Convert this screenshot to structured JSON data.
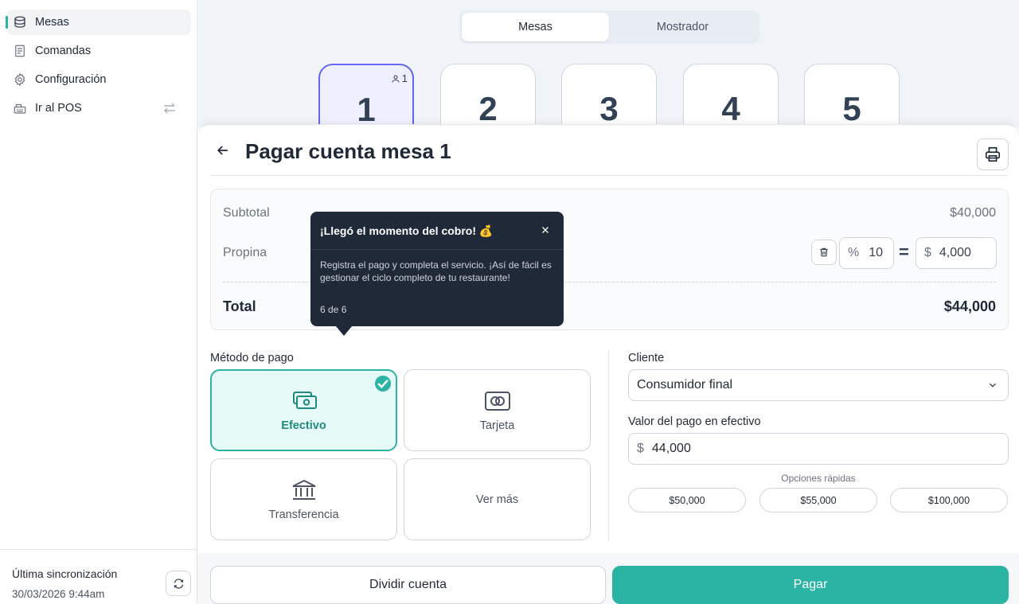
{
  "sidebar": {
    "items": [
      {
        "label": "Mesas",
        "icon": "layers-icon"
      },
      {
        "label": "Comandas",
        "icon": "receipt-icon"
      },
      {
        "label": "Configuración",
        "icon": "gear-icon"
      },
      {
        "label": "Ir al POS",
        "icon": "register-icon"
      }
    ],
    "sync_label": "Última sincronización",
    "sync_time": "30/03/2026 9:44am"
  },
  "segment": {
    "tabs": [
      "Mesas",
      "Mostrador"
    ],
    "active": "Mesas"
  },
  "tables": [
    {
      "number": "1",
      "guests": "1"
    },
    {
      "number": "2"
    },
    {
      "number": "3"
    },
    {
      "number": "4"
    },
    {
      "number": "5"
    }
  ],
  "panel": {
    "title": "Pagar cuenta mesa 1",
    "subtotal_label": "Subtotal",
    "subtotal_value": "$40,000",
    "tip_label": "Propina",
    "tip_percent_symbol": "%",
    "tip_percent": "10",
    "tip_equals": "=",
    "tip_currency": "$",
    "tip_amount": "4,000",
    "total_label": "Total",
    "total_value": "$44,000"
  },
  "payment": {
    "label": "Método de pago",
    "methods": [
      "Efectivo",
      "Tarjeta",
      "Transferencia",
      "Ver más"
    ],
    "selected": "Efectivo"
  },
  "client": {
    "label": "Cliente",
    "value": "Consumidor final",
    "cash_label": "Valor del pago en efectivo",
    "cash_currency": "$",
    "cash_value": "44,000",
    "quick_label": "Opciones rápidas",
    "quick_options": [
      "$50,000",
      "$55,000",
      "$100,000"
    ]
  },
  "footer": {
    "split_label": "Dividir cuenta",
    "pay_label": "Pagar"
  },
  "tour": {
    "title": "¡Llegó el momento del cobro! 💰",
    "body": "Registra el pago y completa el servicio. ¡Así de fácil es gestionar el ciclo completo de tu restaurante!",
    "step": "6 de 6"
  },
  "colors": {
    "accent": "#2bb3a3",
    "selected_table": "#6366f1",
    "tooltip_bg": "#1f2937"
  }
}
